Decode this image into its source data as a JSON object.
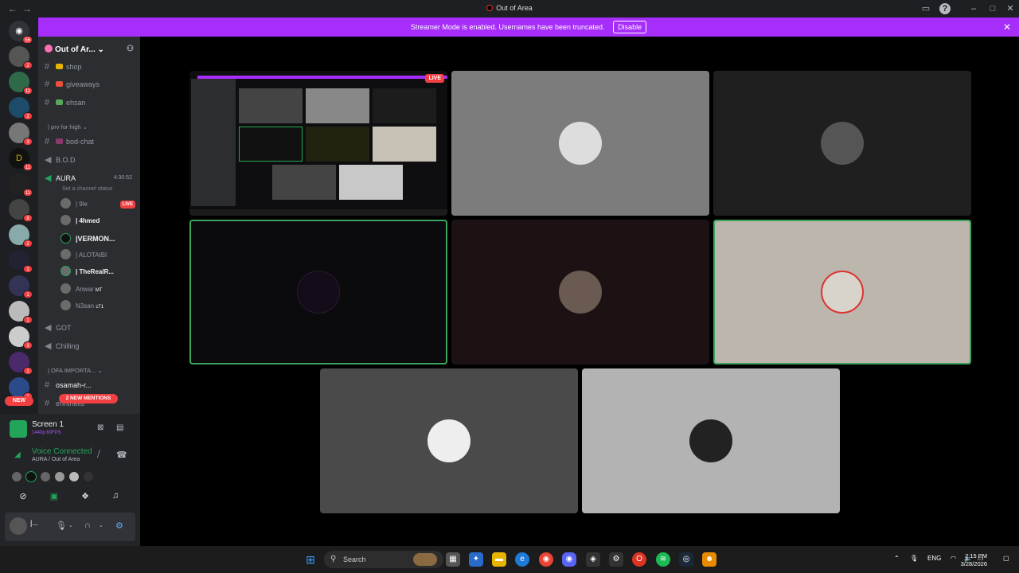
{
  "window": {
    "title": "Out of Area"
  },
  "banner": {
    "text": "Streamer Mode is enabled. Usernames have been truncated.",
    "action": "Disable"
  },
  "servers": {
    "home_badge": "56",
    "badges": [
      "2",
      "11",
      "2",
      "3",
      "11",
      "11",
      "8",
      "2",
      "1",
      "1",
      "1",
      "3",
      "1",
      "1"
    ],
    "new_label": "NEW"
  },
  "guild": {
    "name": "Out of Ar..."
  },
  "channels": {
    "shop": "shop",
    "giveaways": "giveaways",
    "ehsan": "ehsan",
    "category_prv": "| prv for high",
    "bod_chat": "bod-chat",
    "bod": "B.O.D",
    "aura": "AURA",
    "aura_timer": "4:30:52",
    "aura_status": "Set a channel status",
    "got": "GOT",
    "chilling": "Chilling",
    "category_ofa": "| OFA IMPORTA...",
    "osamah": "osamah-r...",
    "last_channel": "ehnthelis",
    "mentions_pill": "2 NEW MENTIONS"
  },
  "voice_users": [
    {
      "name": "| 9le",
      "live": "LIVE"
    },
    {
      "name": "| 4hmed"
    },
    {
      "name": "|VERMON..."
    },
    {
      "name": "| ALOTAIBI"
    },
    {
      "name": "| TheRealR..."
    },
    {
      "name": "Anwar",
      "tag": "MT"
    },
    {
      "name": "N3san",
      "tag": "c71"
    }
  ],
  "screenshare": {
    "title": "Screen 1",
    "sub": "1440p 60FPS"
  },
  "voice_connection": {
    "title": "Voice Connected",
    "sub": "AURA / Out of Area"
  },
  "user": {
    "name": "|..."
  },
  "stage": {
    "live_label": "LIVE"
  },
  "taskbar": {
    "search": "Search",
    "lang": "ENG",
    "time": "2:15 PM",
    "date": "3/28/2026"
  },
  "colors": {
    "accent": "#a62dfa",
    "live": "#f23f42",
    "speaking": "#3ba55d",
    "connected": "#23a559"
  }
}
